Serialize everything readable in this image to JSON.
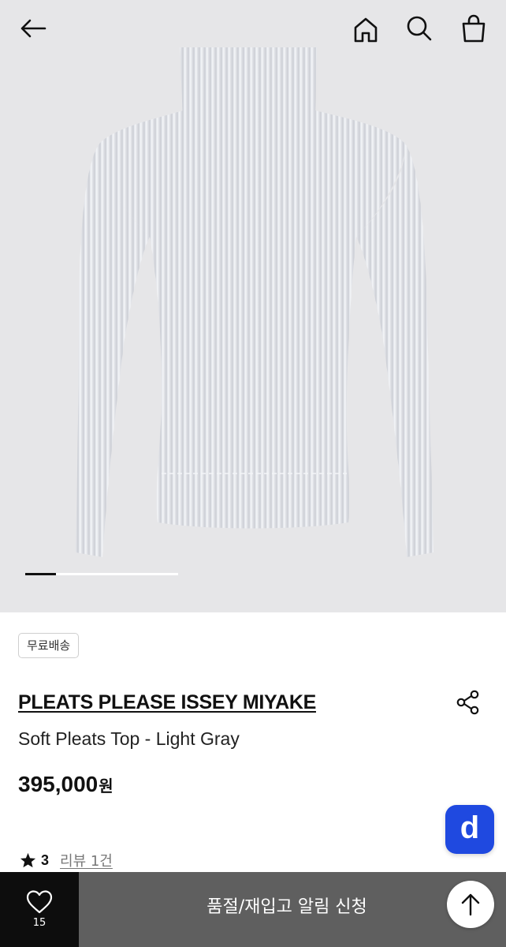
{
  "header": {
    "back_icon": "arrow-left-icon",
    "home_icon": "home-icon",
    "search_icon": "search-icon",
    "cart_icon": "shopping-bag-icon"
  },
  "gallery": {
    "current_index": 1,
    "progress_fraction": 0.2
  },
  "product": {
    "badge": "무료배송",
    "brand": "PLEATS PLEASE ISSEY MIYAKE",
    "name": "Soft Pleats Top - Light Gray",
    "price": "395,000",
    "price_unit": "원",
    "rating": "3",
    "review_link": "리뷰 1건",
    "share_icon": "share-icon"
  },
  "floating": {
    "d_button_label": "d"
  },
  "bottom_bar": {
    "like_icon": "heart-icon",
    "like_count": "15",
    "restock_label": "품절/재입고 알림 신청",
    "scroll_top_icon": "arrow-up-icon"
  },
  "colors": {
    "hero_bg": "#e6e6e8",
    "accent_blue": "#1f49e0",
    "bottom_dark": "#0d0d0d",
    "bottom_gray": "#5f5f5f"
  }
}
